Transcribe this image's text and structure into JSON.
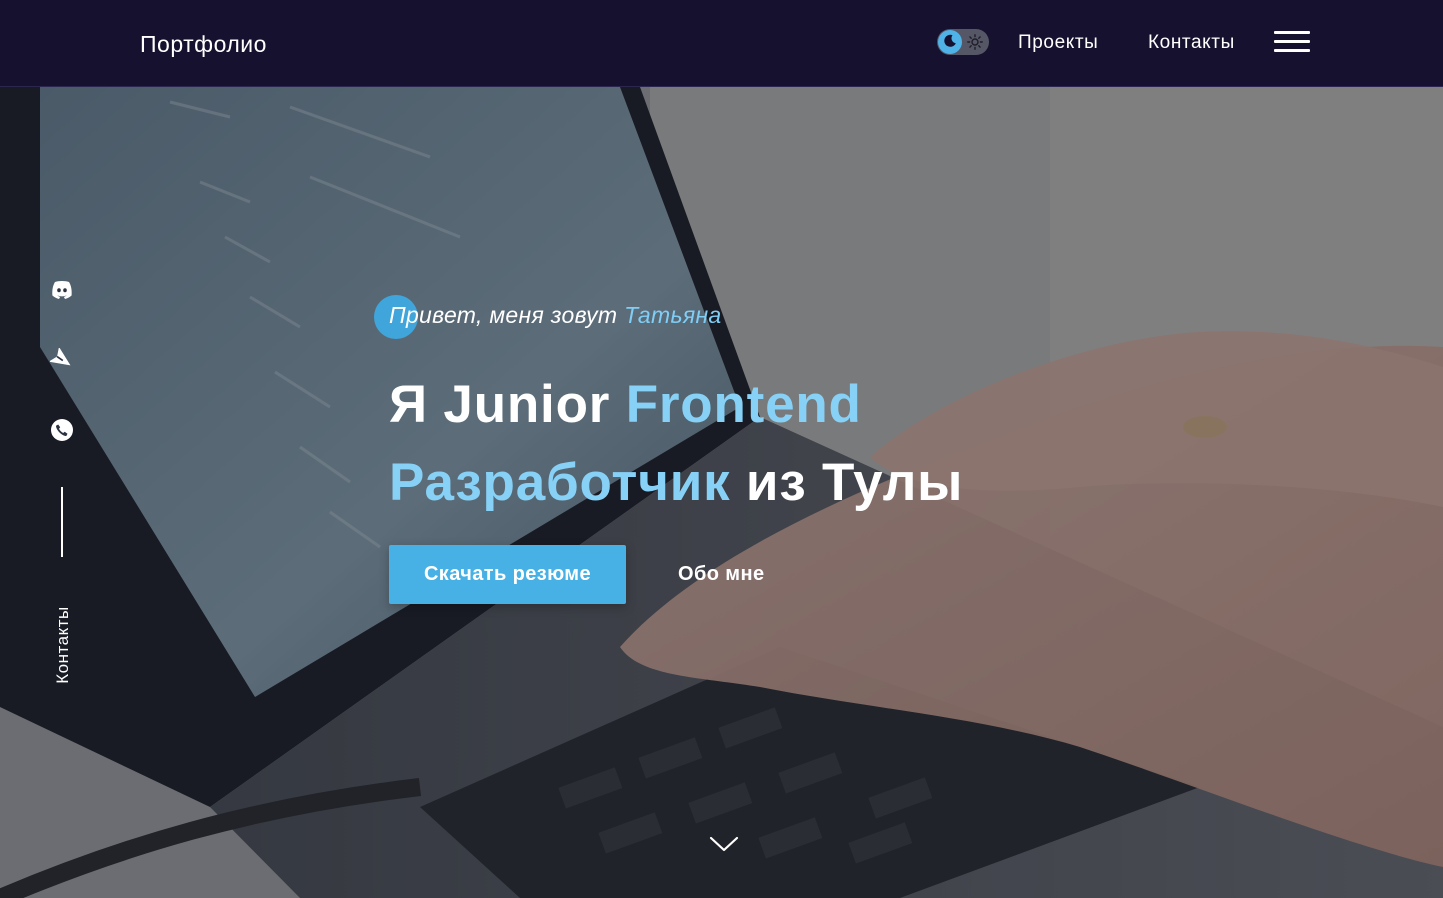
{
  "header": {
    "logo": "Портфолио",
    "nav": {
      "projects": "Проекты",
      "contacts": "Контакты"
    },
    "theme_toggle": {
      "state": "dark",
      "icons": [
        "moon-icon",
        "sun-icon"
      ],
      "accent_color": "#4fb3e8"
    },
    "menu_icon": "hamburger-icon"
  },
  "sidebar": {
    "icons": [
      "discord-icon",
      "telegram-icon",
      "phone-icon"
    ],
    "label": "Контакты"
  },
  "hero": {
    "greeting_prefix": "Привет, меня зовут ",
    "greeting_name": "Татьяна",
    "headline_part1": "Я Junior ",
    "headline_accent1": "Frontend",
    "headline_accent2": "Разработчик",
    "headline_part2": " из Тулы",
    "primary_button": "Скачать резюме",
    "secondary_button": "Обо мне",
    "scroll_icon": "chevron-down-icon"
  },
  "colors": {
    "header_bg": "#15112f",
    "accent": "#87d1f7",
    "button_bg": "#47b1e6",
    "text": "#ffffff"
  }
}
